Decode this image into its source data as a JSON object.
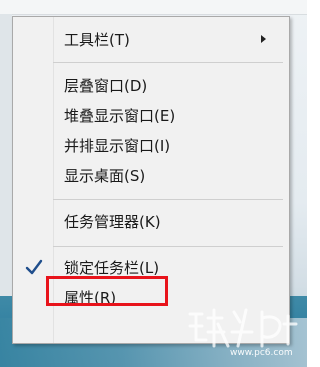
{
  "menu": {
    "toolbars": "工具栏(T)",
    "cascade": "层叠窗口(D)",
    "stacked": "堆叠显示窗口(E)",
    "side_by_side": "并排显示窗口(I)",
    "show_desktop": "显示桌面(S)",
    "task_manager": "任务管理器(K)",
    "lock_taskbar": "锁定任务栏(L)",
    "properties": "属性(R)"
  },
  "lock_taskbar_checked": true,
  "watermark": {
    "url": "www.pc6.com"
  },
  "colors": {
    "highlight_border": "#e8131b",
    "menu_background": "#f1f1f1",
    "check_color": "#1f4e8c"
  },
  "icons": {
    "submenu": "chevron-right-icon",
    "check": "check-icon"
  }
}
